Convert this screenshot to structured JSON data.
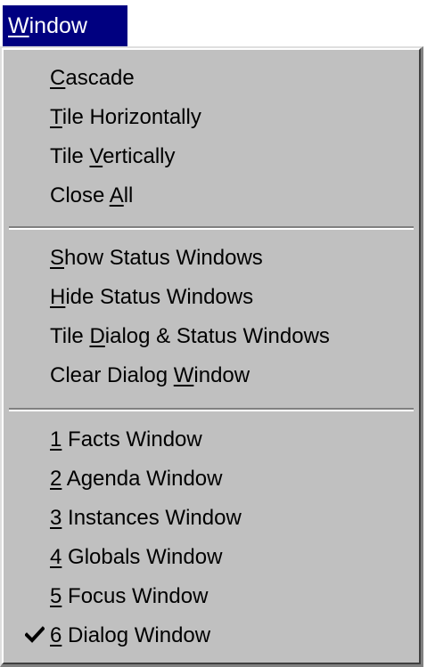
{
  "menu_title": {
    "mnemonic": "W",
    "rest": "indow"
  },
  "group1": [
    {
      "before": "",
      "mnemonic": "C",
      "after": "ascade"
    },
    {
      "before": "",
      "mnemonic": "T",
      "after": "ile Horizontally"
    },
    {
      "before": "Tile ",
      "mnemonic": "V",
      "after": "ertically"
    },
    {
      "before": "Close ",
      "mnemonic": "A",
      "after": "ll"
    }
  ],
  "group2": [
    {
      "before": "",
      "mnemonic": "S",
      "after": "how Status Windows"
    },
    {
      "before": "",
      "mnemonic": "H",
      "after": "ide Status Windows"
    },
    {
      "before": "Tile ",
      "mnemonic": "D",
      "after": "ialog & Status Windows"
    },
    {
      "before": "Clear Dialog ",
      "mnemonic": "W",
      "after": "indow"
    }
  ],
  "group3": [
    {
      "before": "",
      "mnemonic": "1",
      "after": " Facts Window"
    },
    {
      "before": "",
      "mnemonic": "2",
      "after": " Agenda Window"
    },
    {
      "before": "",
      "mnemonic": "3",
      "after": " Instances Window"
    },
    {
      "before": "",
      "mnemonic": "4",
      "after": " Globals Window"
    },
    {
      "before": "",
      "mnemonic": "5",
      "after": " Focus Window"
    },
    {
      "before": "",
      "mnemonic": "6",
      "after": " Dialog Window",
      "checked": true,
      "check_icon": "checkmark-icon"
    }
  ],
  "colors": {
    "menu_bg": "#c0c0c0",
    "title_bg": "#000080",
    "title_fg": "#ffffff",
    "text": "#000000"
  }
}
